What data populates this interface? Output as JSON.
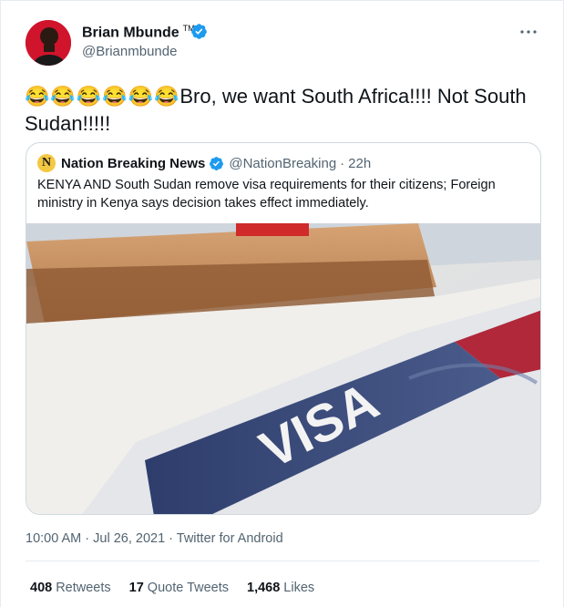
{
  "author": {
    "display_name": "Brian Mbunde",
    "tm": "TM",
    "handle": "@Brianmbunde",
    "verified": true
  },
  "tweet": {
    "emojis": "😂😂😂😂😂😂",
    "text": "Bro, we want South Africa!!!! Not South Sudan!!!!!"
  },
  "quoted_tweet": {
    "avatar_letter": "N",
    "display_name": "Nation Breaking News",
    "handle": "@NationBreaking",
    "separator": "·",
    "time": "22h",
    "text": "KENYA AND South Sudan remove visa requirements for their citizens; Foreign ministry in Kenya says decision takes effect immediately.",
    "image_text": "VISA"
  },
  "meta": {
    "line": "10:00 AM · Jul 26, 2021 · Twitter for Android"
  },
  "stats": {
    "retweets_count": "408",
    "retweets_label": "Retweets",
    "quotes_count": "17",
    "quotes_label": "Quote Tweets",
    "likes_count": "1,468",
    "likes_label": "Likes"
  },
  "colors": {
    "verified": "#1d9bf0",
    "muted": "#536471",
    "border": "#cfd9de"
  }
}
